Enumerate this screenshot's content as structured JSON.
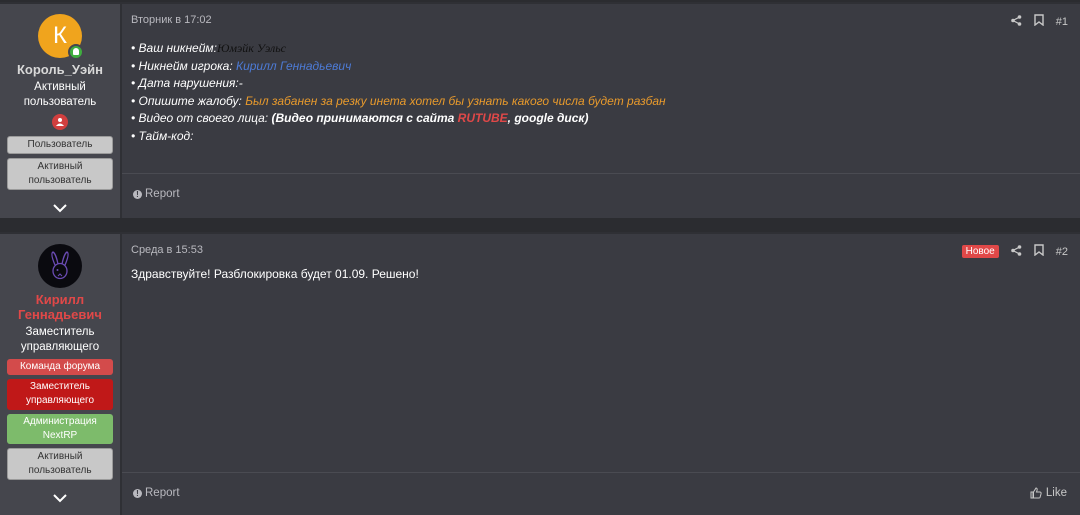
{
  "posts": [
    {
      "author": {
        "avatar_letter": "К",
        "username": "Король_Уэйн",
        "title": "Активный пользователь",
        "badges": [
          "Пользователь",
          "Активный пользователь"
        ]
      },
      "date": "Вторник в 17:02",
      "number": "#1",
      "lines": {
        "nick_label": "• Ваш никнейм:",
        "nick_value": "Юмэйк Уэльс",
        "player_label": "• Никнейм игрока:",
        "player_value": "Кирилл Геннадьевич",
        "date_label": "• Дата нарушения:-",
        "complaint_label": "• Опишите жалобу:",
        "complaint_value": "Был забанен за резку инета хотел бы узнать какого числа будет разбан",
        "video_label": "• Видео от своего лица:",
        "video_value_start": "(Видео принимаются с сайта",
        "video_rutube": "RUTUBE",
        "video_value_end": ", google диск)",
        "timecode_label": "• Тайм-код:"
      },
      "report_label": "Report"
    },
    {
      "author": {
        "username": "Кирилл Геннадьевич",
        "title": "Заместитель управляющего",
        "badges": [
          "Команда форума",
          "Заместитель управляющего",
          "Администрация NextRP",
          "Активный пользователь"
        ]
      },
      "date": "Среда в 15:53",
      "new_label": "Новое",
      "number": "#2",
      "body": "Здравствуйте! Разблокировка будет 01.09. Решено!",
      "report_label": "Report",
      "like_label": "Like"
    }
  ],
  "colors": {
    "background": "#2b2c30",
    "post_bg": "#3a3b42",
    "sidebar_bg": "#45464d",
    "staff_red": "#e04848",
    "avatar_orange": "#f0a41d"
  }
}
